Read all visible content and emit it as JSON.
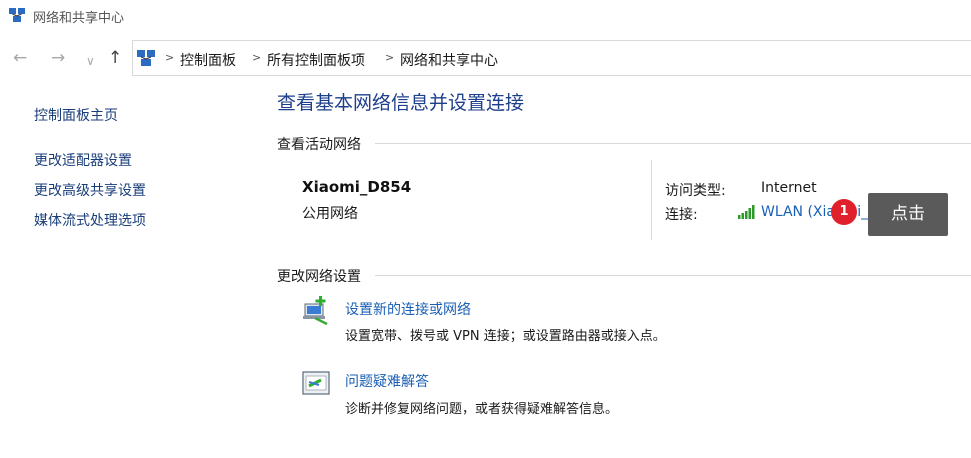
{
  "window": {
    "title": "网络和共享中心",
    "icon": "network-sharing-center-icon"
  },
  "nav": {
    "back_icon": "←",
    "forward_icon": "→",
    "history_icon": "∨",
    "up_icon": "↑"
  },
  "breadcrumb": {
    "separator": ">",
    "items": [
      "控制面板",
      "所有控制面板项",
      "网络和共享中心"
    ]
  },
  "sidebar": {
    "items": [
      {
        "label": "控制面板主页"
      },
      {
        "label": "更改适配器设置"
      },
      {
        "label": "更改高级共享设置"
      },
      {
        "label": "媒体流式处理选项"
      }
    ]
  },
  "main": {
    "title": "查看基本网络信息并设置连接",
    "active_networks_heading": "查看活动网络",
    "network": {
      "name": "Xiaomi_D854",
      "type": "公用网络",
      "access_type_label": "访问类型:",
      "access_type_value": "Internet",
      "connection_label": "连接:",
      "connection_value": "WLAN (Xiaomi_D854)"
    },
    "change_settings_heading": "更改网络设置",
    "tasks": [
      {
        "link": "设置新的连接或网络",
        "desc": "设置宽带、拨号或 VPN 连接；或设置路由器或接入点。",
        "icon": "new-connection-icon"
      },
      {
        "link": "问题疑难解答",
        "desc": "诊断并修复网络问题，或者获得疑难解答信息。",
        "icon": "troubleshoot-icon"
      }
    ]
  },
  "annotation": {
    "badge": "1",
    "tooltip": "点击"
  },
  "colors": {
    "link": "#1a5fb4",
    "title": "#1e3f8c",
    "badge": "#e0202a",
    "tooltip_bg": "#5a5a5a"
  }
}
